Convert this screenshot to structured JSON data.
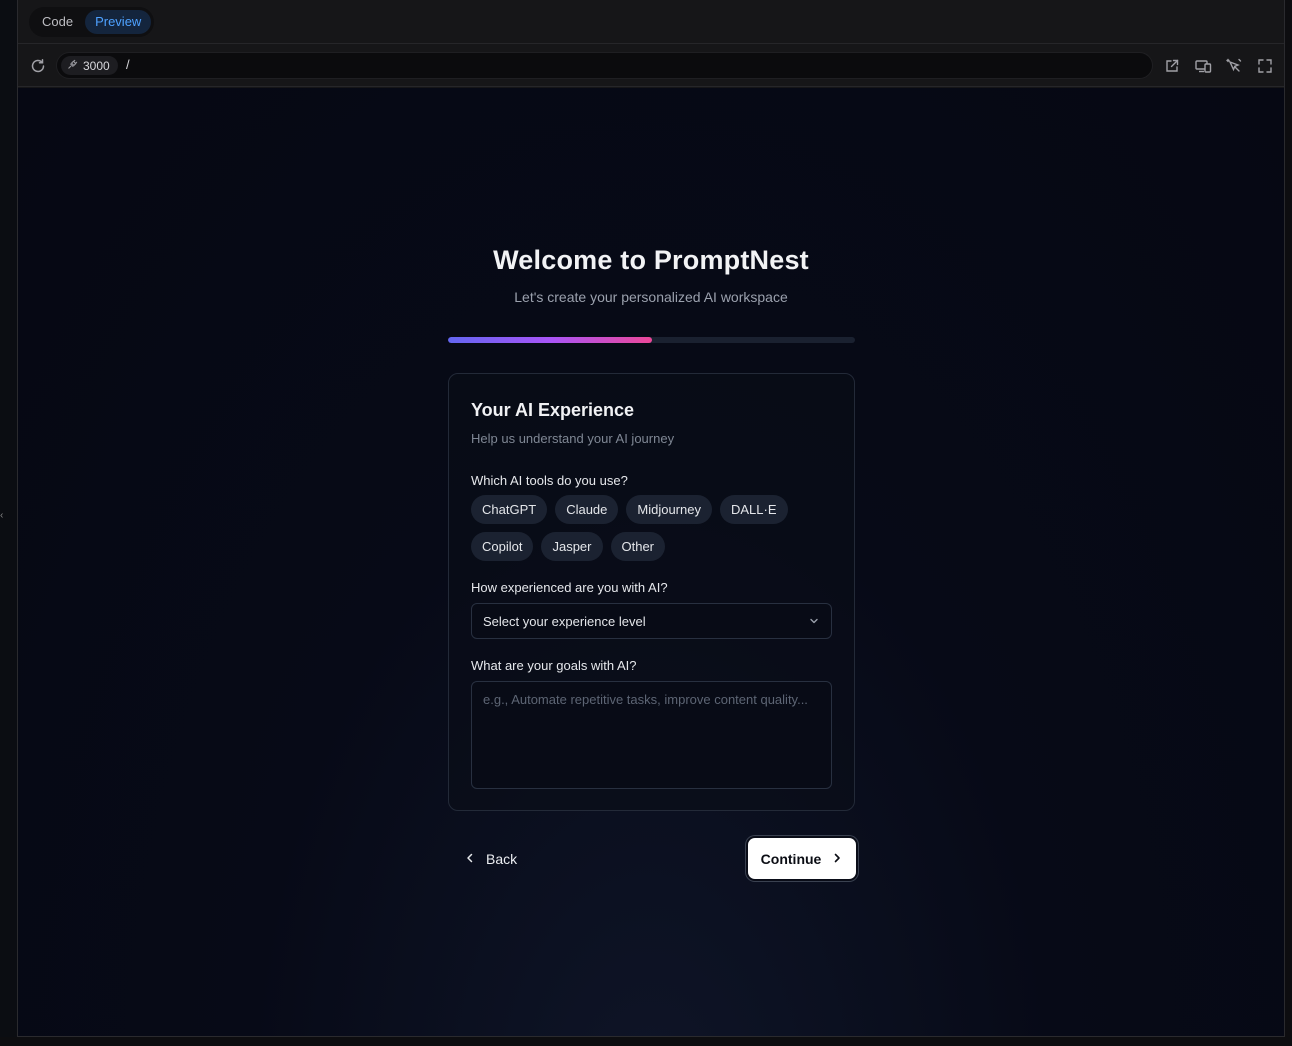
{
  "editor": {
    "tabs": [
      {
        "label": "Code",
        "active": false
      },
      {
        "label": "Preview",
        "active": true
      }
    ],
    "address": {
      "port": "3000",
      "path": "/"
    },
    "icons": [
      "reload-icon",
      "plug-icon",
      "open-external-icon",
      "responsive-icon",
      "inspect-icon",
      "fullscreen-icon"
    ]
  },
  "page": {
    "title": "Welcome to PromptNest",
    "subtitle": "Let's create your personalized AI workspace",
    "progress_fraction": 0.5,
    "progress_colors": [
      "#6366f1",
      "#a855f7",
      "#ec4899"
    ]
  },
  "card": {
    "title": "Your AI Experience",
    "subtitle": "Help us understand your AI journey",
    "tools_label": "Which AI tools do you use?",
    "tools": [
      "ChatGPT",
      "Claude",
      "Midjourney",
      "DALL·E",
      "Copilot",
      "Jasper",
      "Other"
    ],
    "experience_label": "How experienced are you with AI?",
    "experience_value": "Select your experience level",
    "goals_label": "What are your goals with AI?",
    "goals_placeholder": "e.g., Automate repetitive tasks, improve content quality..."
  },
  "nav": {
    "back_label": "Back",
    "continue_label": "Continue"
  }
}
